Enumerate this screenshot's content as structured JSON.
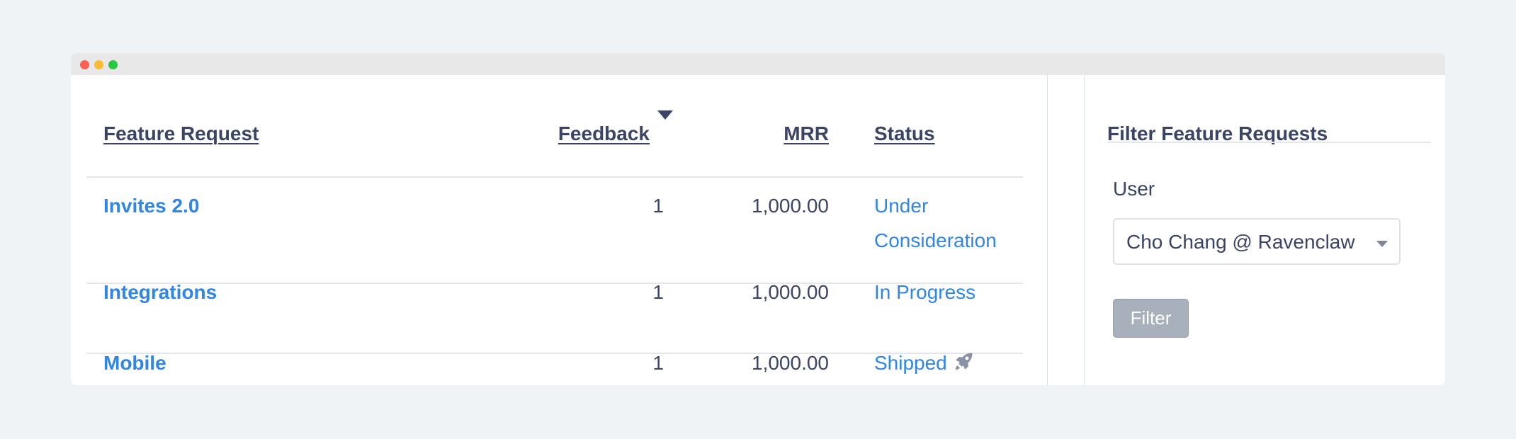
{
  "window": {
    "controls": [
      "close",
      "minimize",
      "maximize"
    ]
  },
  "table": {
    "headers": {
      "feature_request": "Feature Request",
      "feedback": "Feedback",
      "mrr": "MRR",
      "status": "Status"
    },
    "sort": {
      "column": "Feedback",
      "direction": "descending",
      "icon": "caret-down-icon"
    },
    "rows": [
      {
        "name": "Invites 2.0",
        "feedback": "1",
        "mrr": "1,000.00",
        "status": "Under Consideration",
        "status_icon": null
      },
      {
        "name": "Integrations",
        "feedback": "1",
        "mrr": "1,000.00",
        "status": "In Progress",
        "status_icon": null
      },
      {
        "name": "Mobile",
        "feedback": "1",
        "mrr": "1,000.00",
        "status": "Shipped",
        "status_icon": "rocket-icon"
      }
    ]
  },
  "sidebar": {
    "title": "Filter Feature Requests",
    "user_label": "User",
    "user_select": {
      "selected": "Cho Chang @ Ravenclaw"
    },
    "filter_button": "Filter"
  },
  "colors": {
    "background": "#f0f3f6",
    "link": "#2f86e5",
    "text": "#3c4466",
    "button_disabled": "#a8b0bc"
  }
}
